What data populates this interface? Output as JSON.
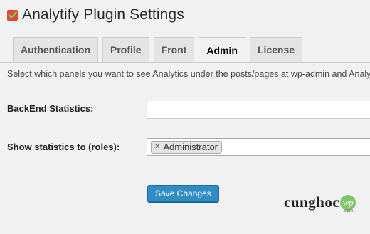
{
  "header": {
    "logo_icon": "checkmark-icon",
    "title": "Analytify Plugin Settings"
  },
  "tabs": [
    {
      "label": "Authentication",
      "active": false
    },
    {
      "label": "Profile",
      "active": false
    },
    {
      "label": "Front",
      "active": false
    },
    {
      "label": "Admin",
      "active": true
    },
    {
      "label": "License",
      "active": false
    }
  ],
  "admin": {
    "intro": "Select which panels you want to see Analytics under the posts/pages at wp-admin and Analytics",
    "backend_label": "BackEnd Statistics:",
    "backend_value": "",
    "roles_label": "Show statistics to (roles):",
    "roles_selected": [
      "Administrator"
    ],
    "remove_glyph": "×"
  },
  "actions": {
    "save_label": "Save Changes"
  },
  "watermark": {
    "text": "cunghoc",
    "badge": "wp",
    "sub": ".com"
  },
  "colors": {
    "accent": "#2f8cc4",
    "logo_green": "#7fc56b",
    "logo_red": "#e2473a"
  }
}
